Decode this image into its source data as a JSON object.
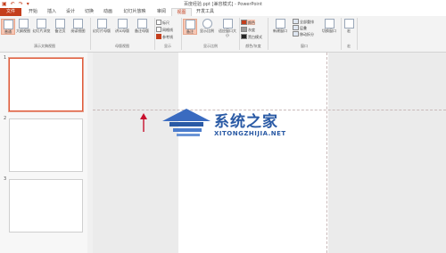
{
  "window": {
    "title": "百度经验.ppt [兼容模式] - PowerPoint",
    "qat": [
      "▣",
      "↶",
      "↷",
      "▾"
    ]
  },
  "tabs": [
    "文件",
    "开始",
    "插入",
    "设计",
    "切换",
    "动画",
    "幻灯片放映",
    "审阅",
    "视图",
    "开发工具"
  ],
  "ribbon": {
    "view_buttons": [
      "普通",
      "大纲视图",
      "幻灯片浏览",
      "备注页",
      "阅读视图"
    ],
    "master_buttons": [
      "幻灯片母版",
      "讲义母版",
      "备注母版"
    ],
    "show_checks": [
      "标尺",
      "网格线",
      "参考线"
    ],
    "zoom_buttons": [
      "备注",
      "显示比例",
      "适应窗口大小"
    ],
    "color_options": [
      "颜色",
      "灰度",
      "黑白模式"
    ],
    "window_buttons": [
      "新建窗口"
    ],
    "window_options": [
      "全部重排",
      "层叠",
      "移动拆分"
    ],
    "switch_button": "切换窗口",
    "macro_button": "宏",
    "groups": [
      "演示文稿视图",
      "母版视图",
      "显示",
      "显示比例",
      "颜色/灰度",
      "窗口",
      "宏"
    ]
  },
  "slides": [
    {
      "number": "1"
    },
    {
      "number": "2"
    },
    {
      "number": "3"
    }
  ],
  "watermark": {
    "text": "系统之家",
    "url": "XITONGZHIJIA.NET"
  },
  "colors": {
    "accent": "#c43e1c",
    "watermark": "#2a5aa5",
    "arrow": "#c8102e"
  }
}
